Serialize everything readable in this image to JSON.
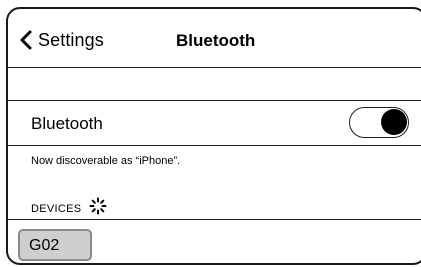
{
  "navbar": {
    "back_label": "Settings",
    "back_icon": "chevron-left-icon",
    "title": "Bluetooth"
  },
  "bluetooth": {
    "label": "Bluetooth",
    "toggle_on": true,
    "toggle_color": "#000000"
  },
  "discoverable_text": "Now discoverable as “iPhone”.",
  "devices": {
    "header": "DEVICES",
    "spinner_icon": "loading-spinner-icon",
    "items": [
      {
        "label": "G02",
        "highlight_color": "#cfcfcf"
      }
    ]
  }
}
